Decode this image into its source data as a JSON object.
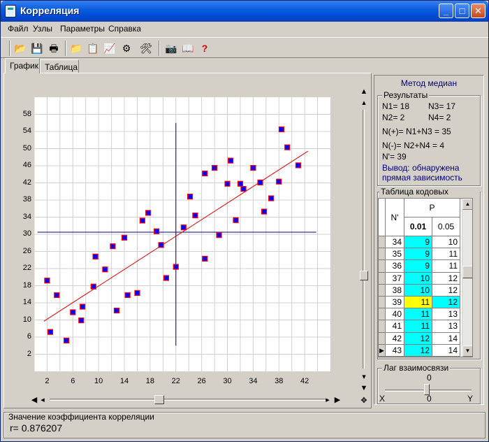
{
  "window": {
    "title": "Корреляция",
    "controls": [
      "_",
      "□",
      "✕"
    ]
  },
  "menu": [
    "Файл",
    "Узлы",
    "Параметры",
    "Справка"
  ],
  "toolbar": {
    "icons": [
      "open-folder-icon",
      "save-icon",
      "print-icon",
      "import-icon",
      "export-icon",
      "chart-icon",
      "nodes-icon",
      "tools-icon",
      "camera-icon",
      "book-icon",
      "help-icon"
    ],
    "glyphs": [
      "📂",
      "💾",
      "🖶",
      "📁",
      "📋",
      "📈",
      "⚙",
      "🛠",
      "📷",
      "📖",
      "?"
    ]
  },
  "tabs": [
    "График",
    "Таблица"
  ],
  "chart_data": {
    "type": "scatter",
    "xlim": [
      0,
      46
    ],
    "ylim": [
      -2,
      62
    ],
    "x_ticks": [
      2,
      6,
      10,
      14,
      18,
      22,
      26,
      30,
      34,
      38,
      42
    ],
    "y_ticks": [
      2,
      6,
      10,
      14,
      18,
      22,
      26,
      30,
      34,
      38,
      42,
      46,
      50,
      54,
      58
    ],
    "grid": true,
    "median_x": 22,
    "median_y": 30.5,
    "trend_line": {
      "x1": 1.5,
      "y1": 9.7,
      "x2": 42.5,
      "y2": 49.4
    },
    "points": [
      [
        2,
        19.2
      ],
      [
        3.5,
        15.8
      ],
      [
        5,
        5.2
      ],
      [
        6,
        11.8
      ],
      [
        7.3,
        9.9
      ],
      [
        7.5,
        13.1
      ],
      [
        2.5,
        7.2
      ],
      [
        9.2,
        17.8
      ],
      [
        9.5,
        24.8
      ],
      [
        11,
        21.8
      ],
      [
        12.2,
        27.2
      ],
      [
        12.8,
        12.2
      ],
      [
        14,
        29.2
      ],
      [
        14.5,
        15.8
      ],
      [
        16,
        16.3
      ],
      [
        16.8,
        33.2
      ],
      [
        17.7,
        35.0
      ],
      [
        19,
        30.7
      ],
      [
        19.7,
        27.5
      ],
      [
        20.5,
        19.8
      ],
      [
        22,
        22.4
      ],
      [
        23.2,
        31.6
      ],
      [
        24.2,
        38.8
      ],
      [
        25,
        34.4
      ],
      [
        26.5,
        24.3
      ],
      [
        26.5,
        44.2
      ],
      [
        28,
        45.5
      ],
      [
        28.7,
        29.8
      ],
      [
        30,
        41.8
      ],
      [
        30.5,
        47.2
      ],
      [
        31.3,
        33.3
      ],
      [
        32,
        41.8
      ],
      [
        32.5,
        40.6
      ],
      [
        34,
        45.5
      ],
      [
        35.1,
        42.1
      ],
      [
        35.7,
        35.3
      ],
      [
        36.8,
        38.4
      ],
      [
        38,
        42.3
      ],
      [
        38.4,
        54.5
      ],
      [
        39.3,
        50.3
      ],
      [
        41,
        46.1
      ]
    ]
  },
  "side": {
    "method": "Метод медиан",
    "results_title": "Результаты",
    "n1": "N1= 18",
    "n3": "N3= 17",
    "n2": "N2= 2",
    "n4": "N4= 2",
    "nplus": "N(+)= N1+N3 = 35",
    "nminus": "N(-)= N2+N4 = 4",
    "nprime": "N'=  39",
    "conclusion_1": "Вывод: обнаружена",
    "conclusion_2": "прямая зависимость",
    "table_title": "Таблица кодовых значений",
    "table_header_n": "N'",
    "table_header_p": "P",
    "table_header_p1": "0.01",
    "table_header_p2": "0.05",
    "table_rows": [
      [
        "34",
        "9",
        "10"
      ],
      [
        "35",
        "9",
        "11"
      ],
      [
        "36",
        "9",
        "11"
      ],
      [
        "37",
        "10",
        "12"
      ],
      [
        "38",
        "10",
        "12"
      ],
      [
        "39",
        "11",
        "12"
      ],
      [
        "40",
        "11",
        "13"
      ],
      [
        "41",
        "11",
        "13"
      ],
      [
        "42",
        "12",
        "14"
      ],
      [
        "43",
        "12",
        "14"
      ]
    ],
    "lag_title": "Лаг взаимосвязи",
    "lag_value": "0",
    "lag_left": "X",
    "lag_mid": "0",
    "lag_right": "Y",
    "colors": {
      "cyan": "#00ffff",
      "highlight": "#ffff00"
    }
  },
  "status": {
    "title": "Значение коэффициента корреляции",
    "value": "r= 0.876207"
  }
}
